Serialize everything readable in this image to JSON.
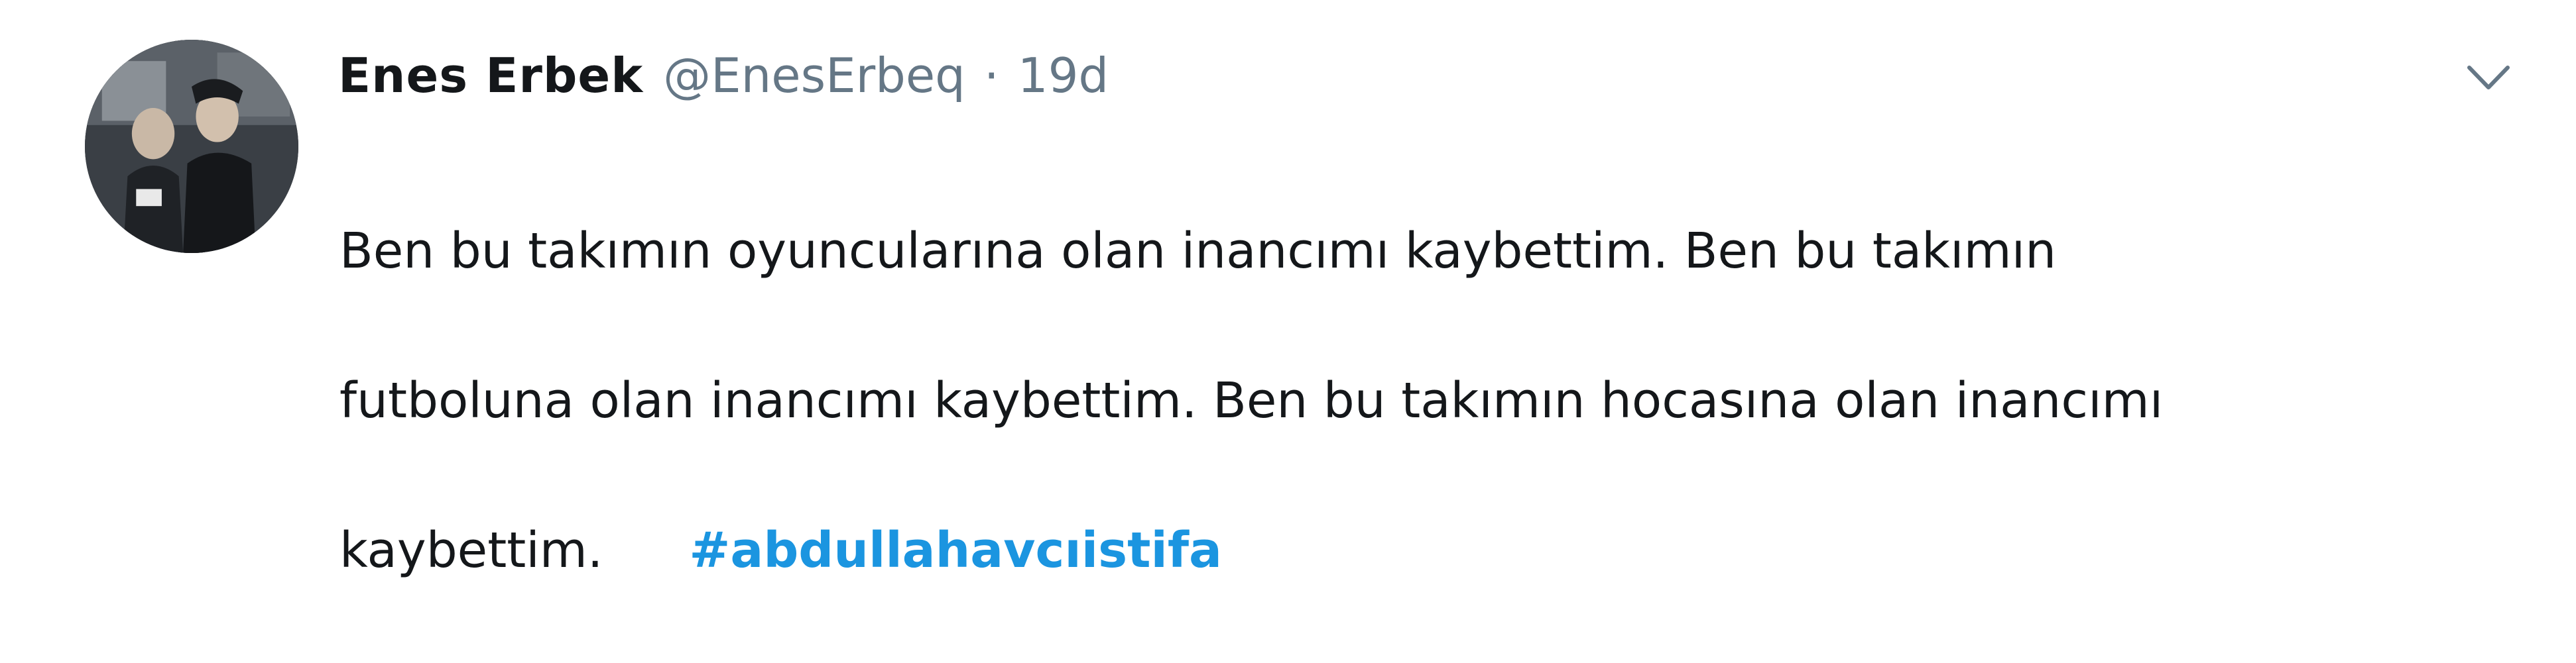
{
  "tweet": {
    "author": {
      "display_name": "Enes Erbek",
      "username": "@EnesErbeq"
    },
    "separator": "·",
    "timestamp": "19d",
    "text_lines": [
      "Ben bu takımın oyuncularına olan inancımı kaybettim. Ben bu takımın",
      "futboluna olan inancımı kaybettim. Ben bu takımın hocasına olan inancımı",
      "kaybettim."
    ],
    "hashtag": "#abdullahavcıistifa",
    "icons": {
      "avatar": "profile-photo",
      "menu": "chevron-down-icon"
    },
    "colors": {
      "name": "#14171a",
      "meta": "#657786",
      "hashtag": "#1b95e0",
      "background": "#ffffff"
    }
  }
}
